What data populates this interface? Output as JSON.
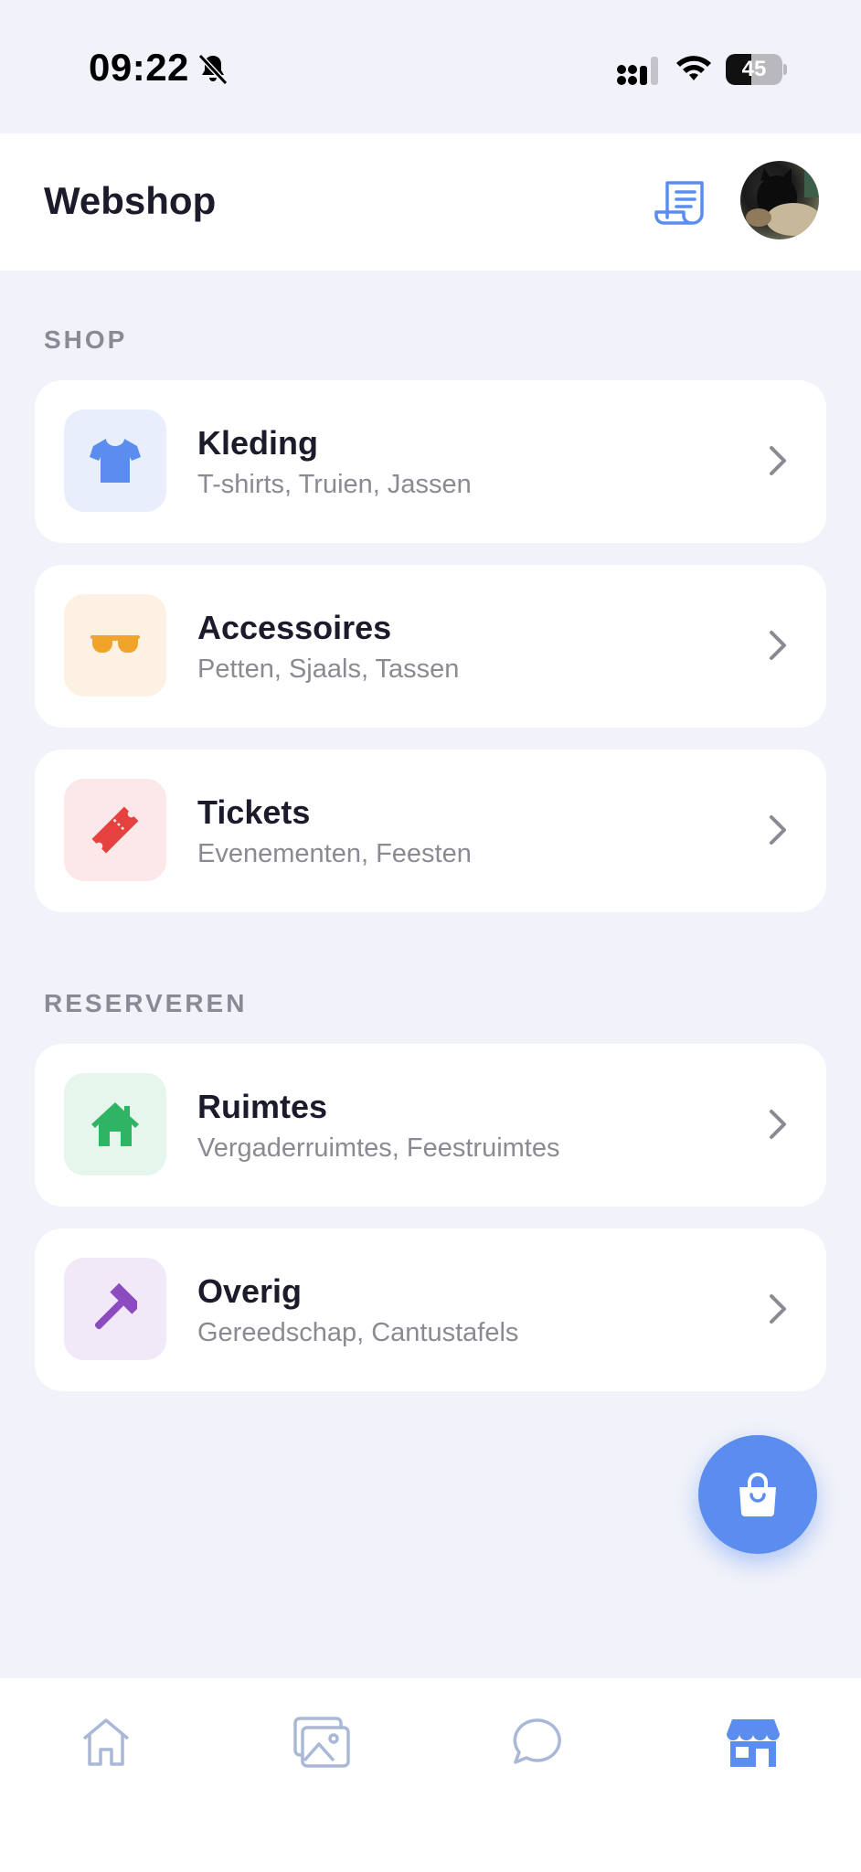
{
  "status_bar": {
    "time": "09:22",
    "battery_level": "45",
    "battery_fraction": 0.45,
    "icons": [
      "bell-slash-icon",
      "cellular-signal-icon",
      "wifi-icon",
      "battery-icon"
    ]
  },
  "header": {
    "title": "Webshop",
    "icons": [
      "receipt-icon",
      "avatar"
    ]
  },
  "sections": [
    {
      "label": "SHOP",
      "items": [
        {
          "title": "Kleding",
          "subtitle": "T-shirts, Truien, Jassen",
          "icon": "tshirt-icon",
          "color": "#5b8def",
          "bg": "#e8eefc"
        },
        {
          "title": "Accessoires",
          "subtitle": "Petten, Sjaals, Tassen",
          "icon": "sunglasses-icon",
          "color": "#f0a42a",
          "bg": "#fdf1e4"
        },
        {
          "title": "Tickets",
          "subtitle": "Evenementen, Feesten",
          "icon": "ticket-icon",
          "color": "#e5413f",
          "bg": "#fce8e8"
        }
      ]
    },
    {
      "label": "RESERVEREN",
      "items": [
        {
          "title": "Ruimtes",
          "subtitle": "Vergaderruimtes, Feestruimtes",
          "icon": "house-icon",
          "color": "#2fb364",
          "bg": "#e6f6ec"
        },
        {
          "title": "Overig",
          "subtitle": "Gereedschap, Cantustafels",
          "icon": "hammer-icon",
          "color": "#8c4cc0",
          "bg": "#f1e9f8"
        }
      ]
    }
  ],
  "fab": {
    "icon": "shopping-bag-icon",
    "color": "#5b8def"
  },
  "bottom_nav": {
    "items": [
      {
        "icon": "home-icon",
        "active": false
      },
      {
        "icon": "gallery-icon",
        "active": false
      },
      {
        "icon": "chat-icon",
        "active": false
      },
      {
        "icon": "shop-icon",
        "active": true
      }
    ],
    "active_color": "#5b8def",
    "inactive_color": "#aab8d8"
  }
}
